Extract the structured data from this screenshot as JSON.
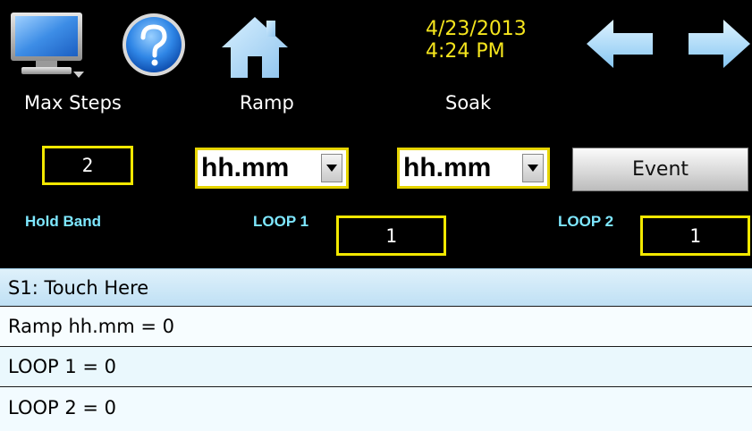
{
  "toolbar": {
    "icons": [
      "monitor-icon",
      "help-icon",
      "home-icon",
      "back-arrow-icon",
      "forward-arrow-icon"
    ],
    "date": "4/23/2013",
    "time": "4:24 PM"
  },
  "headers": {
    "max_steps": "Max Steps",
    "ramp": "Ramp",
    "soak": "Soak"
  },
  "controls": {
    "max_steps_value": "2",
    "ramp_units": "hh.mm",
    "soak_units": "hh.mm",
    "event_label": "Event"
  },
  "hold_band": {
    "label": "Hold Band",
    "loop1_label": "LOOP 1",
    "loop1_value": "1",
    "loop2_label": "LOOP 2",
    "loop2_value": "1"
  },
  "steps": [
    {
      "text": "S1: Touch Here"
    },
    {
      "text": "Ramp hh.mm = 0"
    },
    {
      "text": "LOOP 1 = 0"
    },
    {
      "text": "LOOP 2 = 0"
    }
  ],
  "colors": {
    "accent_yellow": "#f2e800",
    "cyan_label": "#7ee7ff",
    "header_row": "#c6e6f8",
    "row_bg": "#f2fbff"
  }
}
